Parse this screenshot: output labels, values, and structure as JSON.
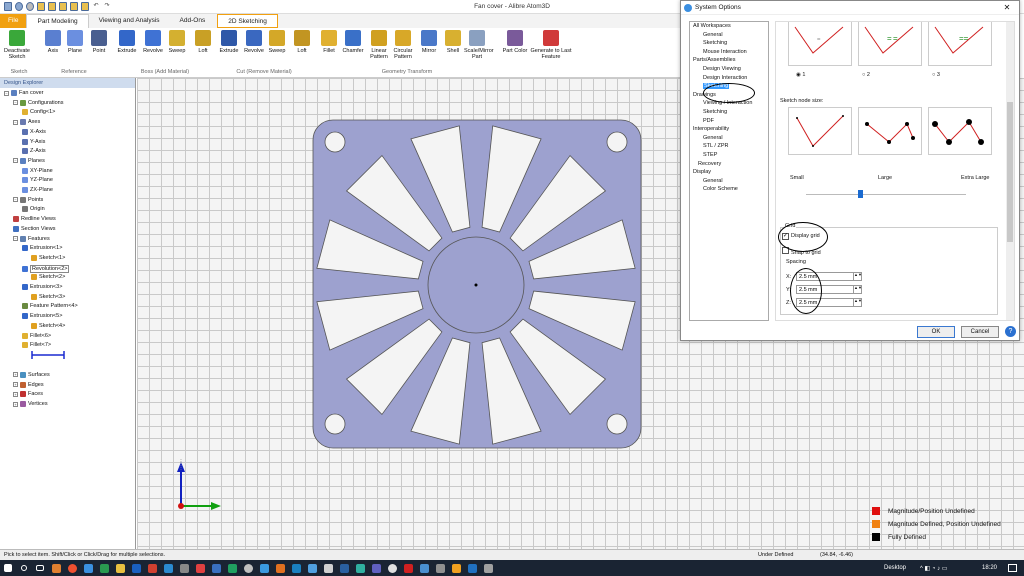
{
  "app": {
    "title": "Fan cover - Alibre Atom3D"
  },
  "tabs": [
    {
      "label": "File"
    },
    {
      "label": "Part Modeling"
    },
    {
      "label": "Viewing and Analysis"
    },
    {
      "label": "Add-Ons"
    },
    {
      "label": "2D Sketching"
    }
  ],
  "ribbon": {
    "buttons": [
      {
        "label": "Deactivate Sketch",
        "color": "#3aa83a"
      },
      {
        "label": "Axis",
        "color": "#5a7fd0"
      },
      {
        "label": "Plane",
        "color": "#6b8fe0"
      },
      {
        "label": "Point",
        "color": "#4a5f90"
      },
      {
        "label": "Extrude",
        "color": "#3367c9"
      },
      {
        "label": "Revolve",
        "color": "#3f72d4"
      },
      {
        "label": "Sweep",
        "color": "#d4b030"
      },
      {
        "label": "Loft",
        "color": "#c9a025"
      },
      {
        "label": "Extrude",
        "color": "#2f58a8"
      },
      {
        "label": "Revolve",
        "color": "#3a68c0"
      },
      {
        "label": "Sweep",
        "color": "#d4a828"
      },
      {
        "label": "Loft",
        "color": "#c29522"
      },
      {
        "label": "Fillet",
        "color": "#e0b030"
      },
      {
        "label": "Chamfer",
        "color": "#3a70c8"
      },
      {
        "label": "Linear Pattern",
        "color": "#d0a020"
      },
      {
        "label": "Circular Pattern",
        "color": "#d8a828"
      },
      {
        "label": "Mirror",
        "color": "#4a78c8"
      },
      {
        "label": "Shell",
        "color": "#d8b030"
      },
      {
        "label": "Scale/Mirror Part",
        "color": "#8aa0c0"
      },
      {
        "label": "Part Color",
        "color": "#7a5a9a"
      },
      {
        "label": "Generate to Last Feature",
        "color": "#d03a3a"
      }
    ],
    "groups": [
      "Sketch",
      "Reference",
      "Boss (Add Material)",
      "Cut (Remove Material)",
      "Geometry Transform"
    ]
  },
  "explorer": {
    "title": "Design Explorer",
    "items": [
      "Fan cover",
      "Configurations",
      "Config<1>",
      "Axes",
      "X-Axis",
      "Y-Axis",
      "Z-Axis",
      "Planes",
      "XY-Plane",
      "YZ-Plane",
      "ZX-Plane",
      "Points",
      "Origin",
      "Redline Views",
      "Section Views",
      "Features",
      "Extrusion<1>",
      "Sketch<1>",
      "Revolution<2>",
      "Sketch<2>",
      "Extrusion<3>",
      "Sketch<3>",
      "Feature Pattern<4>",
      "Extrusion<5>",
      "Sketch<4>",
      "Fillet<6>",
      "Fillet<7>",
      "Surfaces",
      "Edges",
      "Faces",
      "Vertices"
    ]
  },
  "dialog": {
    "title": "System Options",
    "tree": [
      "All Workspaces",
      "General",
      "Sketching",
      "Mouse Interaction",
      "Parts/Assemblies",
      "Design Viewing",
      "Design Interaction",
      "Sketching",
      "Drawings",
      "Viewing / Interaction",
      "Sketching",
      "PDF",
      "Interoperability",
      "General",
      "STL / ZPR",
      "STEP",
      "Recovery",
      "Display",
      "General",
      "Color Scheme"
    ],
    "radio": [
      "1",
      "2",
      "3"
    ],
    "node_size_label": "Sketch node size:",
    "node_sizes": [
      "Small",
      "Large",
      "Extra Large"
    ],
    "grid": {
      "group": "Grid",
      "display": "Display grid",
      "snap": "Snap to grid",
      "spacing": "Spacing",
      "x_label": "X:",
      "y_label": "Y:",
      "z_label": "Z:",
      "x": "2.5 mm",
      "y": "2.5 mm",
      "z": "2.5 mm"
    },
    "ok": "OK",
    "cancel": "Cancel"
  },
  "legend": [
    {
      "label": "Magnitude/Position Undefined",
      "color": "#e01010"
    },
    {
      "label": "Magnitude Defined, Position Undefined",
      "color": "#f08010"
    },
    {
      "label": "Fully Defined",
      "color": "#000000"
    }
  ],
  "status": {
    "hint": "Pick to select item. Shift/Click or Click/Drag for multiple selections.",
    "state": "Under Defined",
    "coords": "(34.84, -6.46)"
  },
  "taskbar": {
    "desktop": "Desktop",
    "time": "18:20"
  }
}
